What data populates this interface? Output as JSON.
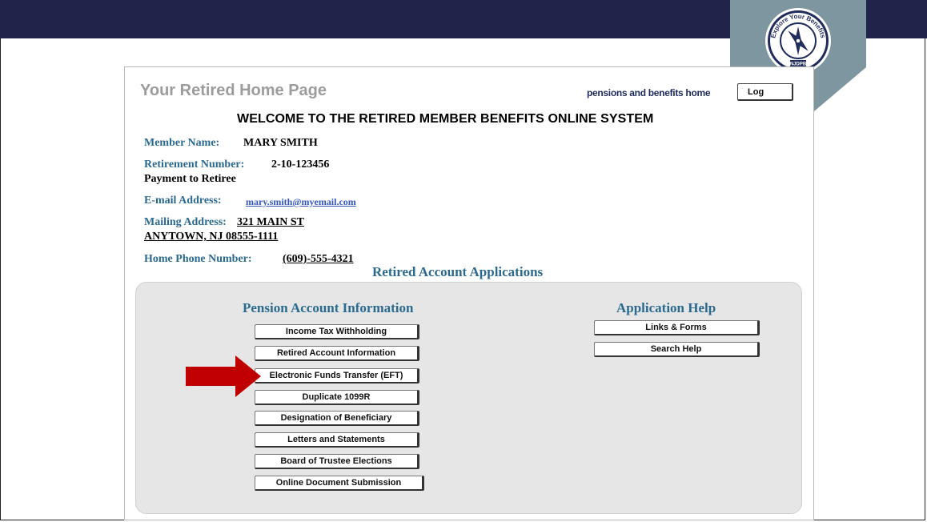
{
  "header": {
    "page_title": "Your Retired Home Page",
    "home_link": "pensions and benefits home",
    "logout_label": "Log",
    "logo_text_top": "Explore Your Benefits",
    "logo_text_bottom": "NJDPB"
  },
  "welcome": "WELCOME TO THE RETIRED MEMBER BENEFITS ONLINE SYSTEM",
  "member": {
    "name_label": "Member Name:",
    "name": "MARY SMITH",
    "retirement_label": "Retirement Number:",
    "retirement_number": "2-10-123456",
    "payment_type": "Payment to Retiree",
    "email_label": "E-mail Address:",
    "email": "mary.smith@myemail.com",
    "mailing_label": "Mailing Address:",
    "address_line1": "321 MAIN ST",
    "address_line2": "ANYTOWN, NJ 08555-1111",
    "phone_label": "Home Phone Number:",
    "phone_area": "(609)",
    "phone_rest": "-555-4321"
  },
  "applications": {
    "heading": "Retired Account Applications",
    "pension": {
      "heading": "Pension Account Information",
      "buttons": [
        "Income Tax Withholding",
        "Retired Account Information",
        "Electronic Funds Transfer (EFT)",
        "Duplicate 1099R",
        "Designation of Beneficiary",
        "Letters and Statements",
        "Board of Trustee Elections",
        "Online Document Submission"
      ]
    },
    "help": {
      "heading": "Application Help",
      "buttons": [
        "Links & Forms",
        "Search Help"
      ]
    }
  },
  "colors": {
    "top_band": "#22234a",
    "badge": "#7e96a0",
    "label_blue": "#2a6a8f",
    "arrow_red": "#c00000"
  }
}
